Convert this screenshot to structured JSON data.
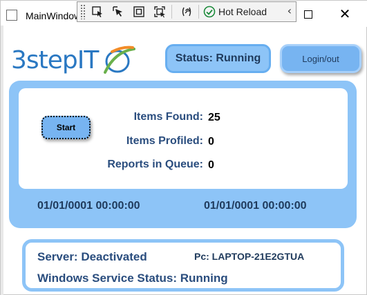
{
  "window": {
    "title": "MainWindow"
  },
  "debug_toolbar": {
    "hot_reload_label": "Hot Reload",
    "tools": [
      "select-element-icon",
      "pointer-icon",
      "layout-adorner-icon",
      "track-focus-icon",
      "binding-failures-icon",
      "hot-reload-check-icon",
      "collapse-chevron-icon"
    ]
  },
  "header": {
    "logo_text": "3stepIT",
    "status_text": "Status: Running",
    "login_label": "Login/out"
  },
  "main": {
    "start_label": "Start",
    "stats": {
      "items_found_label": "Items Found:",
      "items_found_value": "25",
      "items_profiled_label": "Items Profiled:",
      "items_profiled_value": "0",
      "reports_queue_label": "Reports in Queue:",
      "reports_queue_value": "0"
    },
    "date_left": "01/01/0001 00:00:00",
    "date_right": "01/01/0001 00:00:00"
  },
  "info": {
    "server_status": "Server: Deactivated",
    "pc_name": "Pc: LAPTOP-21E2GTUA",
    "service_status": "Windows Service Status: Running"
  },
  "colors": {
    "panel_blue": "#8dc4f7",
    "button_blue": "#77b4f1",
    "label_navy": "#2a4d7e",
    "logo_blue": "#2a78c2",
    "logo_orange": "#f28c28",
    "logo_green": "#6ab04c"
  }
}
